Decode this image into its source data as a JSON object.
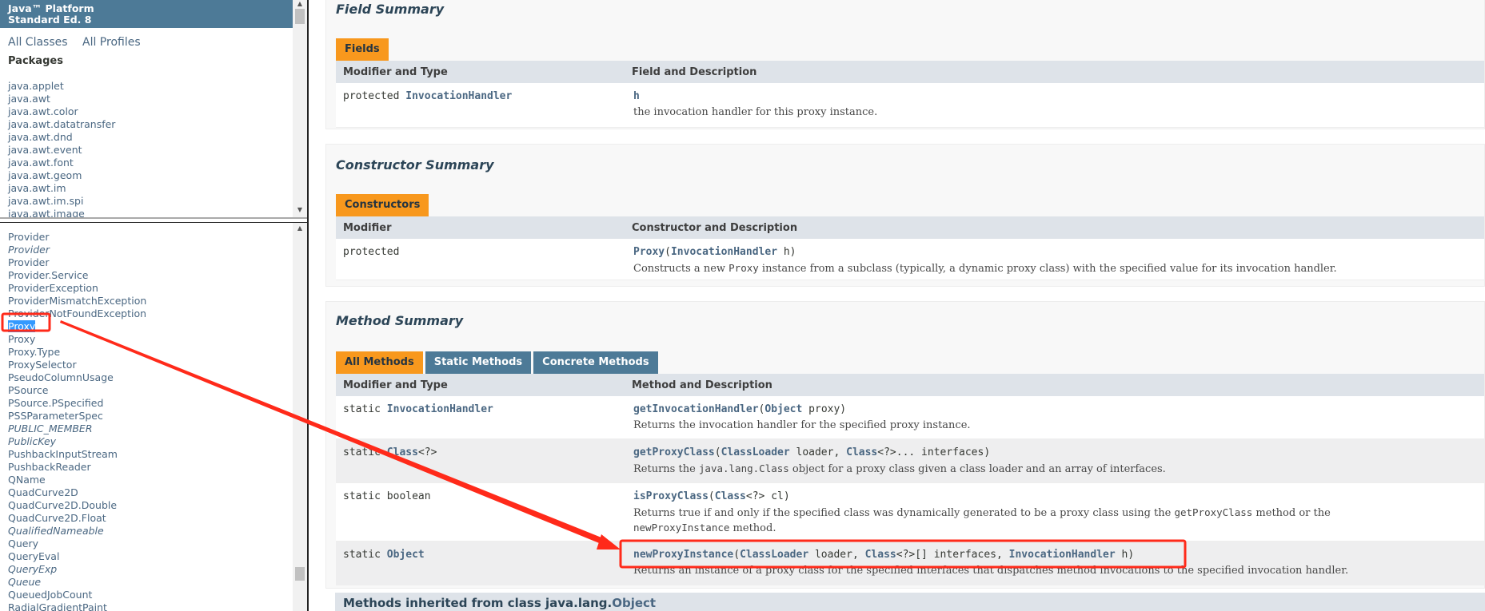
{
  "sidebar": {
    "header": {
      "line1": "Java™ Platform",
      "line2": "Standard Ed. 8"
    },
    "links": [
      "All Classes",
      "All Profiles"
    ],
    "packages_title": "Packages",
    "packages": [
      "java.applet",
      "java.awt",
      "java.awt.color",
      "java.awt.datatransfer",
      "java.awt.dnd",
      "java.awt.event",
      "java.awt.font",
      "java.awt.geom",
      "java.awt.im",
      "java.awt.im.spi",
      "java.awt.image"
    ],
    "classes": [
      {
        "name": "Provider",
        "italic": false
      },
      {
        "name": "Provider",
        "italic": true
      },
      {
        "name": "Provider",
        "italic": false
      },
      {
        "name": "Provider.Service",
        "italic": false
      },
      {
        "name": "ProviderException",
        "italic": false
      },
      {
        "name": "ProviderMismatchException",
        "italic": false
      },
      {
        "name": "ProviderNotFoundException",
        "italic": false
      },
      {
        "name": "Proxy",
        "italic": false,
        "selected": true
      },
      {
        "name": "Proxy",
        "italic": false
      },
      {
        "name": "Proxy.Type",
        "italic": false
      },
      {
        "name": "ProxySelector",
        "italic": false
      },
      {
        "name": "PseudoColumnUsage",
        "italic": false
      },
      {
        "name": "PSource",
        "italic": false
      },
      {
        "name": "PSource.PSpecified",
        "italic": false
      },
      {
        "name": "PSSParameterSpec",
        "italic": false
      },
      {
        "name": "PUBLIC_MEMBER",
        "italic": true
      },
      {
        "name": "PublicKey",
        "italic": true
      },
      {
        "name": "PushbackInputStream",
        "italic": false
      },
      {
        "name": "PushbackReader",
        "italic": false
      },
      {
        "name": "QName",
        "italic": false
      },
      {
        "name": "QuadCurve2D",
        "italic": false
      },
      {
        "name": "QuadCurve2D.Double",
        "italic": false
      },
      {
        "name": "QuadCurve2D.Float",
        "italic": false
      },
      {
        "name": "QualifiedNameable",
        "italic": true
      },
      {
        "name": "Query",
        "italic": false
      },
      {
        "name": "QueryEval",
        "italic": false
      },
      {
        "name": "QueryExp",
        "italic": true
      },
      {
        "name": "Queue",
        "italic": true
      },
      {
        "name": "QueuedJobCount",
        "italic": false
      },
      {
        "name": "RadialGradientPaint",
        "italic": false
      }
    ]
  },
  "field_summary": {
    "title": "Field Summary",
    "tab": "Fields",
    "headers": [
      "Modifier and Type",
      "Field and Description"
    ],
    "rows": [
      {
        "mod": "protected",
        "type": "InvocationHandler",
        "name": "h",
        "desc": "the invocation handler for this proxy instance."
      }
    ]
  },
  "constructor_summary": {
    "title": "Constructor Summary",
    "tab": "Constructors",
    "headers": [
      "Modifier",
      "Constructor and Description"
    ],
    "rows": [
      {
        "mod": "protected",
        "name": "Proxy",
        "p1": "(",
        "t1": "InvocationHandler",
        "p2": " h)",
        "desc_a": "Constructs a new ",
        "desc_code": "Proxy",
        "desc_b": " instance from a subclass (typically, a dynamic proxy class) with the specified value for its invocation handler."
      }
    ]
  },
  "method_summary": {
    "title": "Method Summary",
    "tabs": [
      "All Methods",
      "Static Methods",
      "Concrete Methods"
    ],
    "active_tab": "All Methods",
    "headers": [
      "Modifier and Type",
      "Method and Description"
    ],
    "rows": [
      {
        "mod": "static",
        "type": "InvocationHandler",
        "name": "getInvocationHandler",
        "sig": [
          "(",
          "Object",
          " proxy)"
        ],
        "desc": "Returns the invocation handler for the specified proxy instance."
      },
      {
        "mod": "static",
        "type": "Class",
        "type_suffix": "<?>",
        "name": "getProxyClass",
        "sig": [
          "(",
          "ClassLoader",
          " loader, ",
          "Class",
          "<?>... interfaces)"
        ],
        "desc_a": "Returns the ",
        "desc_code": "java.lang.Class",
        "desc_b": " object for a proxy class given a class loader and an array of interfaces."
      },
      {
        "mod": "static boolean",
        "name": "isProxyClass",
        "sig": [
          "(",
          "Class",
          "<?> cl)"
        ],
        "desc_a": "Returns true if and only if the specified class was dynamically generated to be a proxy class using the ",
        "desc_code1": "getProxyClass",
        "desc_b": " method or the ",
        "desc_code2": "newProxyInstance",
        "desc_c": " method."
      },
      {
        "mod": "static",
        "type": "Object",
        "name": "newProxyInstance",
        "sig": [
          "(",
          "ClassLoader",
          " loader, ",
          "Class",
          "<?>[] interfaces, ",
          "InvocationHandler",
          " h)"
        ],
        "desc": "Returns an instance of a proxy class for the specified interfaces that dispatches method invocations to the specified invocation handler."
      }
    ],
    "inherited_prefix": "Methods inherited from class java.lang.",
    "inherited_link": "Object"
  },
  "colors": {
    "header": "#4d7a97",
    "tab_active": "#f8981d",
    "table_header": "#dee3e9",
    "annotation": "#ff2a1a",
    "selection": "#3399ff"
  }
}
